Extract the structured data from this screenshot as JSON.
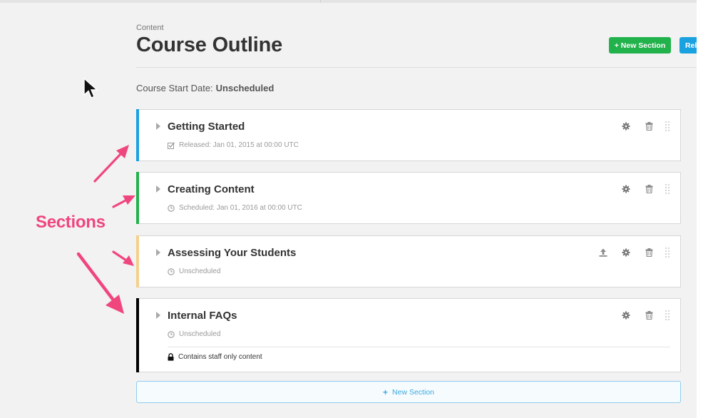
{
  "page": {
    "eyebrow": "Content",
    "title": "Course Outline",
    "new_section_button": "+ New Section",
    "release_button": "Rel",
    "course_start_label": "Course Start Date:",
    "course_start_value": "Unscheduled"
  },
  "sections": [
    {
      "name": "Getting Started",
      "status": "Released: Jan 01, 2015 at 00:00 UTC",
      "status_icon": "checkbox-icon",
      "bar_color": "#1aa1e0"
    },
    {
      "name": "Creating Content",
      "status": "Scheduled: Jan 01, 2016 at 00:00 UTC",
      "status_icon": "clock-icon",
      "bar_color": "#22b24c"
    },
    {
      "name": "Assessing Your Students",
      "status": "Unscheduled",
      "status_icon": "clock-icon",
      "bar_color": "#f5d08a"
    },
    {
      "name": "Internal FAQs",
      "status": "Unscheduled",
      "status_icon": "clock-icon",
      "bar_color": "#000000",
      "staff_note": "Contains staff only content"
    }
  ],
  "footer": {
    "add_section_label": "New Section"
  },
  "annotation": {
    "label": "Sections",
    "color": "#f0467e"
  }
}
